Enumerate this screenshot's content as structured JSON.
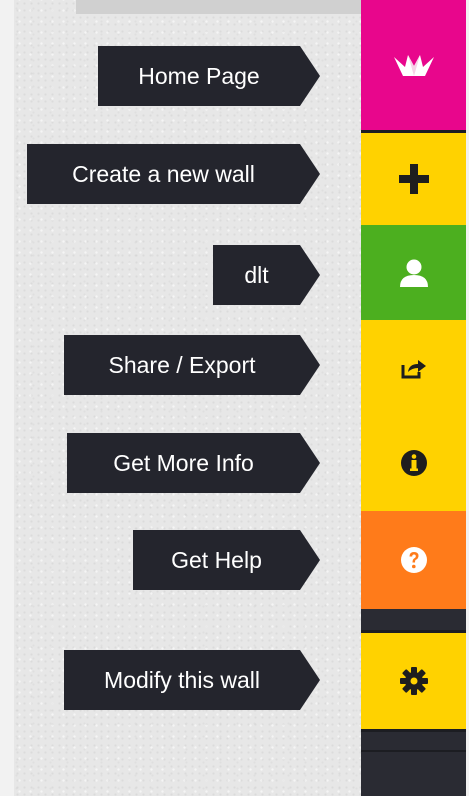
{
  "menu": {
    "items": [
      {
        "key": "home",
        "label": "Home Page",
        "icon": "paper-crane-icon",
        "color": "#e8068c"
      },
      {
        "key": "create",
        "label": "Create a new wall",
        "icon": "plus-icon",
        "color": "#ffd200"
      },
      {
        "key": "user",
        "label": "dlt",
        "icon": "user-icon",
        "color": "#4caf1f"
      },
      {
        "key": "share",
        "label": "Share / Export",
        "icon": "share-icon",
        "color": "#ffd200"
      },
      {
        "key": "info",
        "label": "Get More Info",
        "icon": "info-icon",
        "color": "#ffd200"
      },
      {
        "key": "help",
        "label": "Get Help",
        "icon": "question-icon",
        "color": "#ff7b1a"
      },
      {
        "key": "modify",
        "label": "Modify this wall",
        "icon": "gear-icon",
        "color": "#ffd200"
      }
    ]
  },
  "colors": {
    "tooltip_bg": "#24252d",
    "sidebar_bg": "#2a2b33",
    "background": "#e7e7e7"
  }
}
